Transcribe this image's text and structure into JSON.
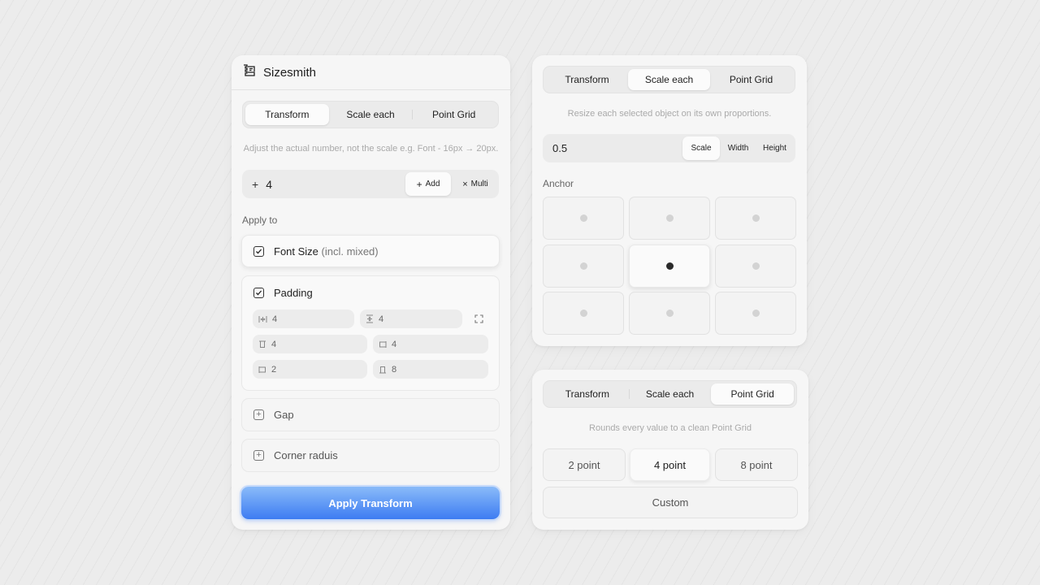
{
  "app": {
    "title": "Sizesmith"
  },
  "tabs": [
    "Transform",
    "Scale each",
    "Point Grid"
  ],
  "transform": {
    "hint": "Adjust the actual number, not the scale e.g. Font - 16px → 20px.",
    "operator_symbol": "+",
    "value": "4",
    "add_label": "Add",
    "multi_label": "Multi",
    "apply_to_label": "Apply to",
    "font_size": {
      "label": "Font Size",
      "sub": "(incl. mixed)"
    },
    "padding": {
      "label": "Padding",
      "horizontal": "4",
      "vertical": "4",
      "top": "4",
      "right": "4",
      "left": "2",
      "bottom": "8"
    },
    "gap_label": "Gap",
    "corner_label": "Corner raduis",
    "apply_button": "Apply Transform"
  },
  "scale_each": {
    "hint": "Resize each selected object on its own proportions.",
    "value": "0.5",
    "modes": [
      "Scale",
      "Width",
      "Height"
    ],
    "active_mode": "Scale",
    "anchor_label": "Anchor",
    "anchor_selected": "center"
  },
  "point_grid": {
    "hint": "Rounds every value to a clean Point Grid",
    "options": [
      "2 point",
      "4 point",
      "8 point"
    ],
    "active_option": "4 point",
    "custom_label": "Custom"
  },
  "colors": {
    "accent_top": "#8abbf9",
    "accent_bottom": "#3d7cf2",
    "panel": "#f6f6f6"
  }
}
